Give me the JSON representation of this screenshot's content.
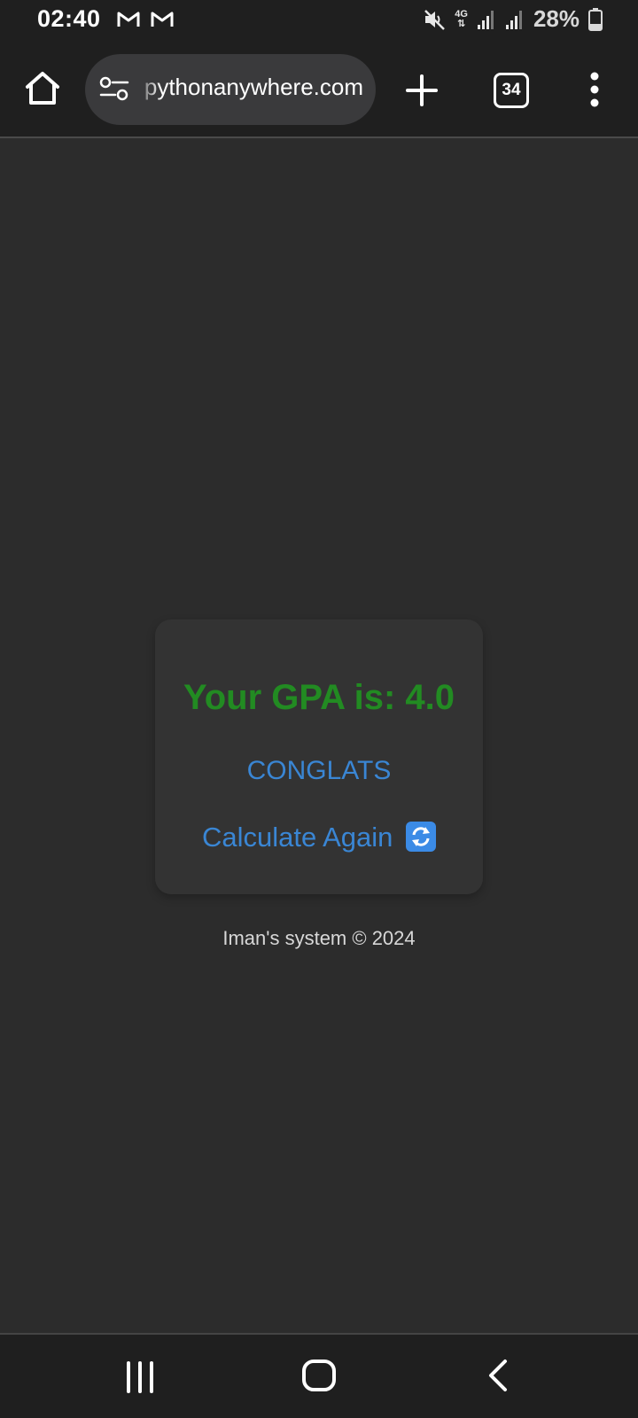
{
  "status_bar": {
    "time": "02:40",
    "notification_icons": [
      "gmail-icon",
      "gmail-icon"
    ],
    "system_icons": [
      "mute-icon",
      "4g-icon",
      "signal-icon",
      "signal-icon"
    ],
    "network_label": "4G",
    "battery_percent": "28%"
  },
  "browser": {
    "url_text": "pythonanywhere.com",
    "tab_count": "34"
  },
  "result": {
    "gpa_text": "Your GPA is: 4.0",
    "message": "CONGLATS",
    "calculate_again_label": "Calculate Again",
    "calculate_again_icon": "refresh-icon"
  },
  "footer": {
    "text": "Iman's system © 2024"
  },
  "colors": {
    "gpa_green": "#228b22",
    "link_blue": "#3a86d4",
    "page_bg": "#2c2c2c",
    "card_bg": "#333333"
  }
}
